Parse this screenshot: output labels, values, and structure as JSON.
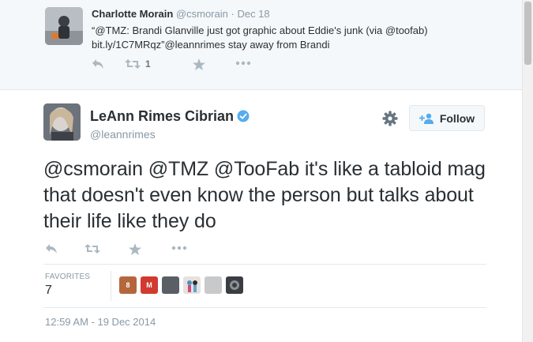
{
  "reply": {
    "name": "Charlotte Morain",
    "handle": "@csmorain",
    "time": "Dec 18",
    "text_line1": "“@TMZ: Brandi Glanville just got graphic about Eddie's junk (via @toofab)",
    "text_line2": "bit.ly/1C7MRqz”@leannrimes stay away from Brandi",
    "retweet_count": "1"
  },
  "tweet": {
    "name": "LeAnn Rimes Cibrian",
    "handle": "@leannrimes",
    "follow_label": "Follow",
    "text": "@csmorain @TMZ @TooFab it's like a tabloid mag that doesn't even know the person but talks about their life like they do",
    "favorites_label": "FAVORITES",
    "favorites_count": "7",
    "favoriter_badges": [
      "8",
      "M"
    ],
    "timestamp": "12:59 AM - 19 Dec 2014"
  },
  "colors": {
    "accent": "#55acee",
    "verified": "#55acee",
    "icon": "#aab8c2",
    "text": "#292f33",
    "muted": "#8899a6"
  },
  "icons": [
    "reply-icon",
    "retweet-icon",
    "favorite-icon",
    "more-icon",
    "gear-icon",
    "follow-add-user-icon",
    "verified-badge-icon"
  ]
}
